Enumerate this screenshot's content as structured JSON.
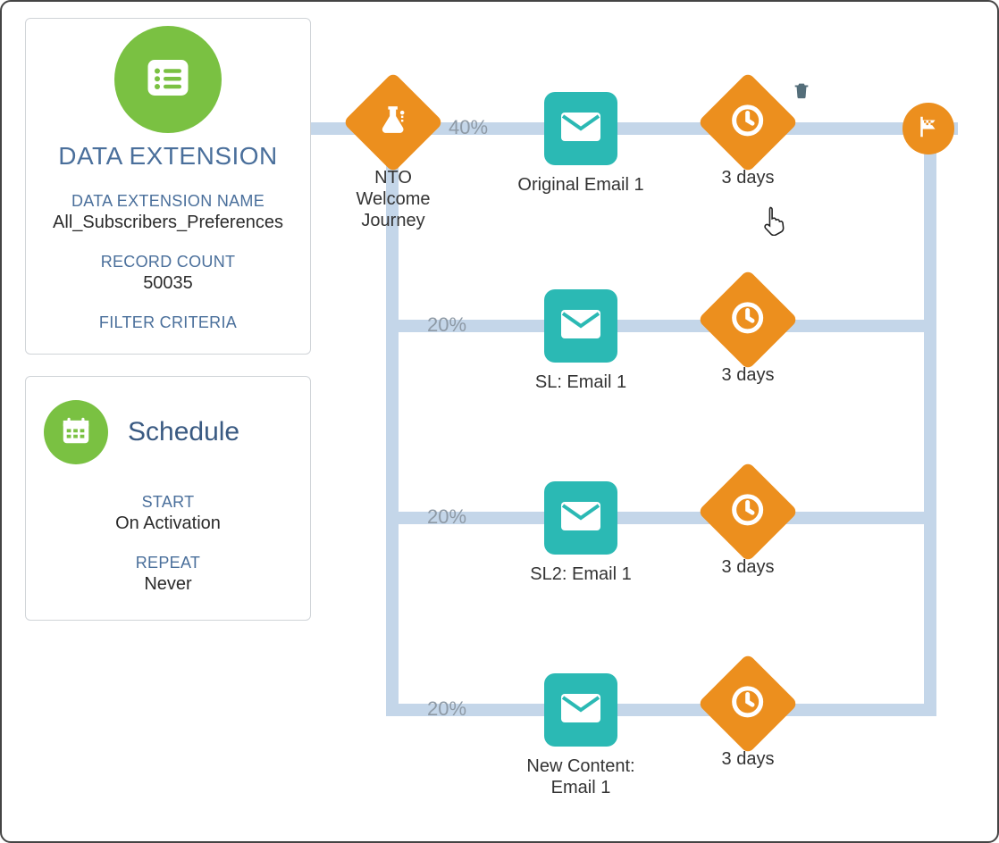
{
  "colors": {
    "orange": "#ec8f1e",
    "teal": "#2bb9b4",
    "green": "#7ac142",
    "blue": "#4a6f9b",
    "connector": "#c4d6e9"
  },
  "data_extension_panel": {
    "title": "DATA EXTENSION",
    "name_label": "DATA EXTENSION NAME",
    "name_value": "All_Subscribers_Preferences",
    "record_count_label": "RECORD COUNT",
    "record_count_value": "50035",
    "filter_criteria_label": "FILTER CRITERIA"
  },
  "schedule_panel": {
    "title": "Schedule",
    "start_label": "START",
    "start_value": "On Activation",
    "repeat_label": "REPEAT",
    "repeat_value": "Never"
  },
  "journey": {
    "split_label": "NTO Welcome Journey",
    "paths": [
      {
        "percent": "40%",
        "email_label": "Original Email 1",
        "wait_label": "3 days"
      },
      {
        "percent": "20%",
        "email_label": "SL: Email 1",
        "wait_label": "3 days"
      },
      {
        "percent": "20%",
        "email_label": "SL2: Email 1",
        "wait_label": "3 days"
      },
      {
        "percent": "20%",
        "email_label": "New Content: Email 1",
        "wait_label": "3 days"
      }
    ]
  },
  "icons": {
    "list": "list-icon",
    "calendar": "calendar-icon",
    "beaker": "beaker-split-icon",
    "envelope": "envelope-icon",
    "clock": "clock-icon",
    "flag": "finish-flag-icon",
    "delete": "delete-icon",
    "cursor": "pointer-cursor-icon"
  }
}
